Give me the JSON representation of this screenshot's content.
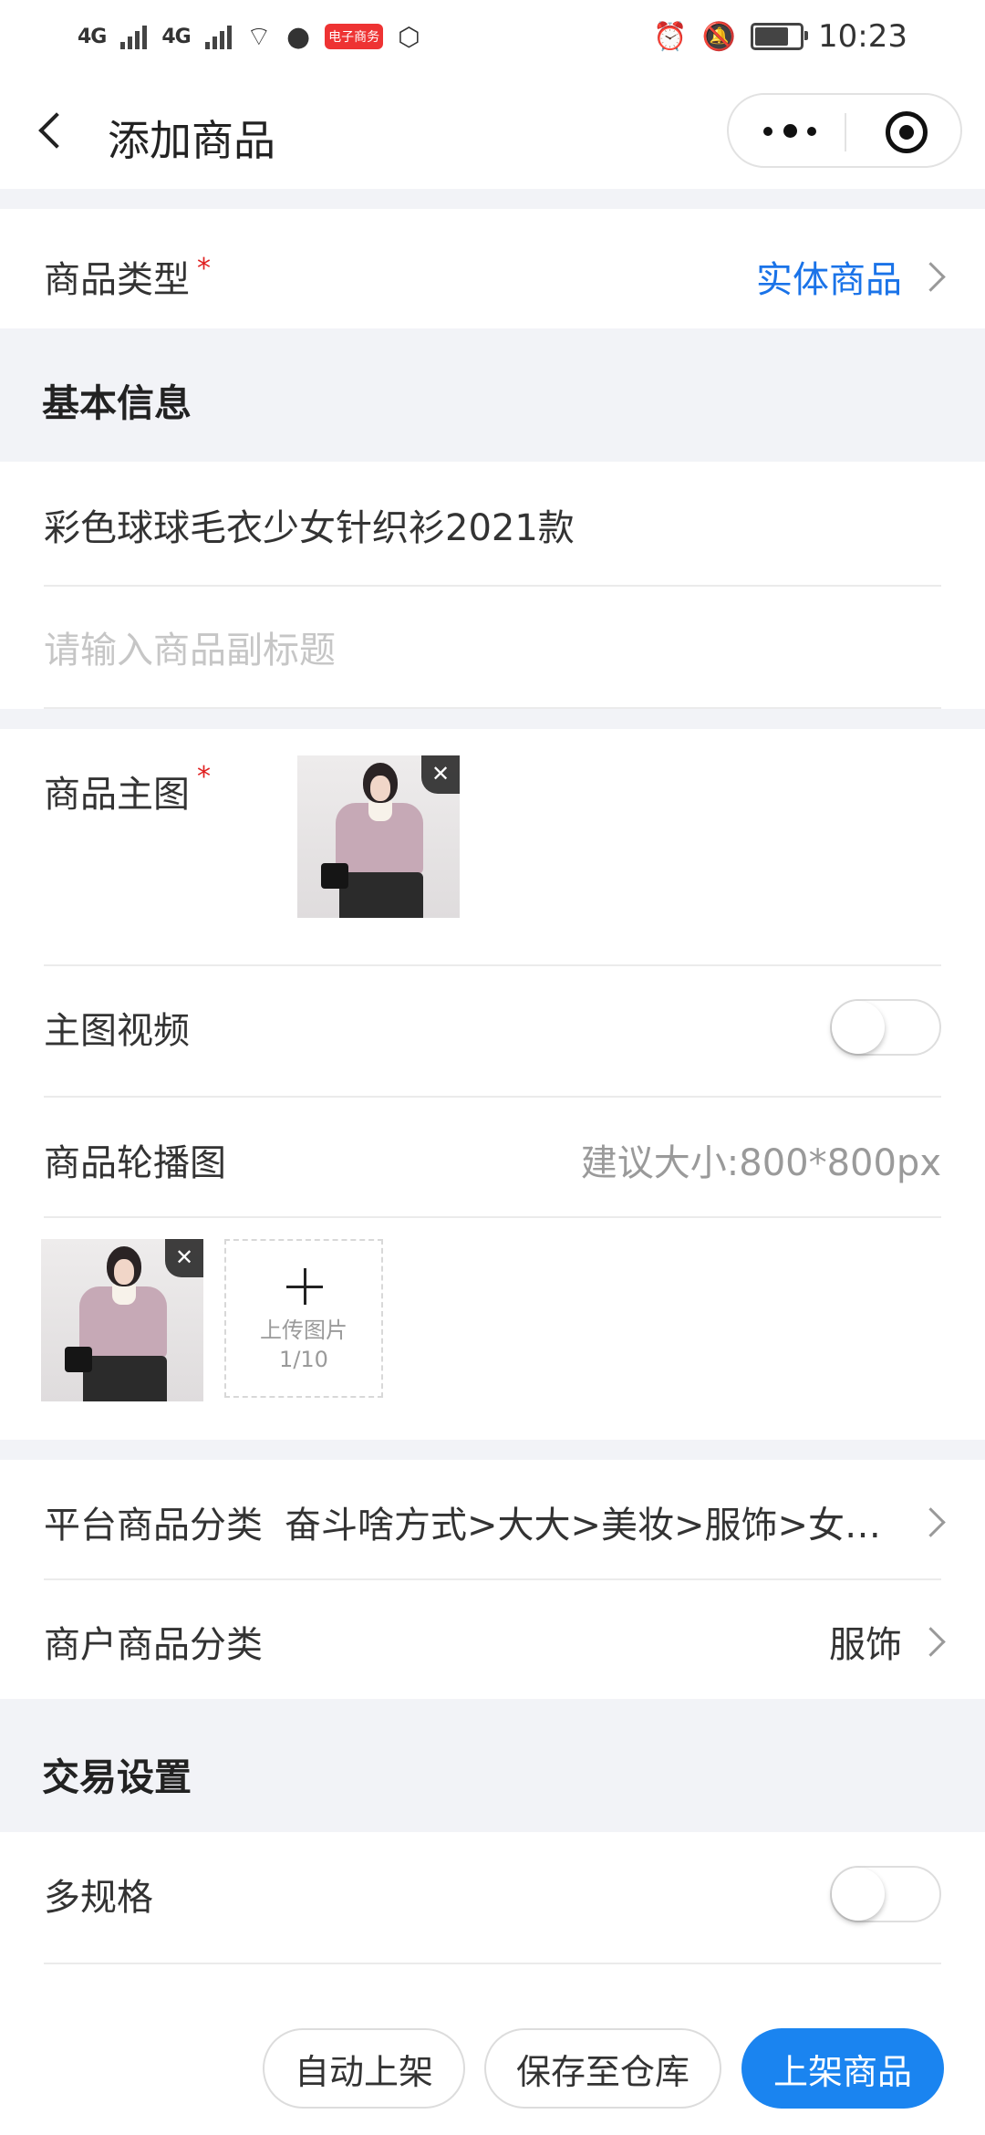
{
  "status_bar": {
    "signal_1": "4G",
    "signal_2": "4G",
    "app_badge": "电子商务",
    "battery_level": 0.7,
    "time": "10:23"
  },
  "nav": {
    "title": "添加商品"
  },
  "product_type": {
    "label": "商品类型",
    "required_mark": "*",
    "value": "实体商品"
  },
  "basic_info": {
    "title": "基本信息",
    "product_name": "彩色球球毛衣少女针织衫2021款",
    "subtitle_placeholder": "请输入商品副标题"
  },
  "media": {
    "main_image_label": "商品主图",
    "required_mark": "*",
    "main_video_label": "主图视频",
    "main_video_enabled": false,
    "carousel_label": "商品轮播图",
    "carousel_hint": "建议大小:800*800px",
    "upload_label": "上传图片",
    "upload_count": "1/10",
    "remove_symbol": "✕"
  },
  "category": {
    "platform_label": "平台商品分类",
    "platform_value": "奋斗啥方式>大大>美妆>服饰>女…",
    "merchant_label": "商户商品分类",
    "merchant_value": "服饰"
  },
  "trade": {
    "title": "交易设置",
    "multi_spec_label": "多规格",
    "multi_spec_enabled": false
  },
  "actions": {
    "auto_list": "自动上架",
    "save_to_warehouse": "保存至仓库",
    "list_product": "上架商品"
  },
  "colors": {
    "accent": "#1a84f0",
    "link": "#1a73e8",
    "required": "#e02020",
    "section_bg": "#f2f3f7"
  }
}
